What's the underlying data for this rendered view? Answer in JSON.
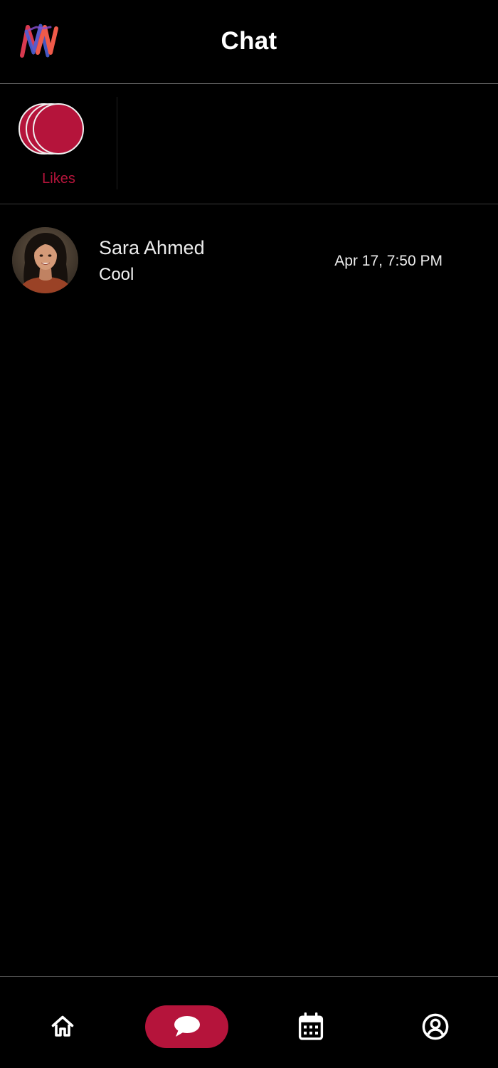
{
  "header": {
    "title": "Chat",
    "logo_icon": "app-logo-icon"
  },
  "likes": {
    "label": "Likes",
    "icon": "stacked-circles-icon",
    "color": "#b5143b"
  },
  "chats": [
    {
      "name": "Sara Ahmed",
      "last_message": "Cool",
      "timestamp": "Apr 17, 7:50 PM",
      "avatar_icon": "profile-photo"
    }
  ],
  "bottom_nav": {
    "items": [
      {
        "id": "home",
        "icon": "home-icon",
        "active": false
      },
      {
        "id": "chat",
        "icon": "chat-bubble-icon",
        "active": true
      },
      {
        "id": "calendar",
        "icon": "calendar-icon",
        "active": false
      },
      {
        "id": "profile",
        "icon": "user-circle-icon",
        "active": false
      }
    ],
    "active_color": "#b5143b"
  },
  "colors": {
    "background": "#000000",
    "accent": "#b5143b",
    "text": "#ffffff"
  }
}
